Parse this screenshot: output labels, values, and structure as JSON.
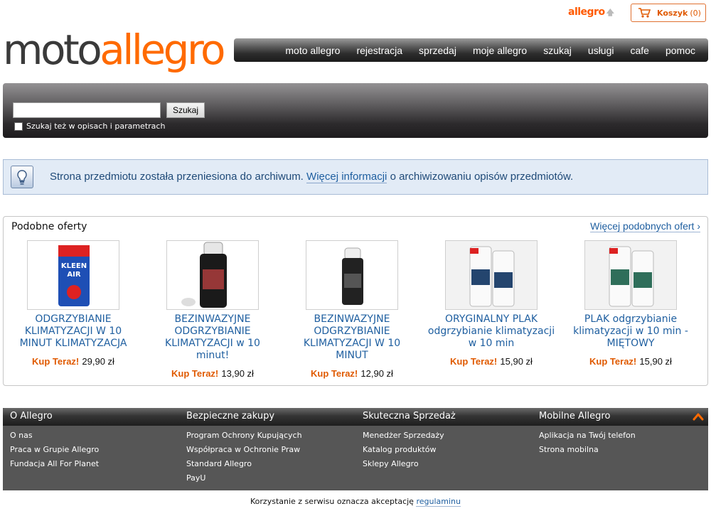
{
  "top": {
    "brand_small": "allegro",
    "cart_label": "Koszyk",
    "cart_count": "(0)"
  },
  "logo": {
    "part1": "moto",
    "part2": "allegro"
  },
  "nav": [
    "moto allegro",
    "rejestracja",
    "sprzedaj",
    "moje allegro",
    "szukaj",
    "usługi",
    "cafe",
    "pomoc"
  ],
  "search": {
    "value": "",
    "button": "Szukaj",
    "checkbox_label": "Szukaj też w opisach i parametrach",
    "checkbox_checked": false
  },
  "info": {
    "text_before": "Strona przedmiotu została przeniesiona do archiwum.",
    "link": "Więcej informacji",
    "text_after": "o archiwizowaniu opisów przedmiotów."
  },
  "similar": {
    "title": "Podobne oferty",
    "more_link": "Więcej podobnych ofert ›",
    "offers": [
      {
        "title": "ODGRZYBIANIE KLIMATYZACJI W 10 MINUT KLIMATYZACJA",
        "buy_label": "Kup Teraz!",
        "price": "29,90 zł",
        "image": "kleen-air-can"
      },
      {
        "title": "BEZINWAZYJNE ODGRZYBIANIE KLIMATYZACJI w 10 minut!",
        "buy_label": "Kup Teraz!",
        "price": "13,90 zł",
        "image": "spray-can-black"
      },
      {
        "title": "BEZINWAZYJNE ODGRZYBIANIE KLIMATYZACJI W 10 MINUT",
        "buy_label": "Kup Teraz!",
        "price": "12,90 zł",
        "image": "spray-can-small"
      },
      {
        "title": "ORYGINALNY PLAK odgrzybianie klimatyzacji w 10 min",
        "buy_label": "Kup Teraz!",
        "price": "15,90 zł",
        "image": "plak-cans"
      },
      {
        "title": "PLAK odgrzybianie klimatyzacji w 10 min - MIĘTOWY",
        "buy_label": "Kup Teraz!",
        "price": "15,90 zł",
        "image": "plak-cans"
      }
    ]
  },
  "footer": {
    "columns": [
      {
        "heading": "O Allegro",
        "links": [
          "O nas",
          "Praca w Grupie Allegro",
          "Fundacja All For Planet"
        ]
      },
      {
        "heading": "Bezpieczne zakupy",
        "links": [
          "Program Ochrony Kupujących",
          "Współpraca w Ochronie Praw",
          "Standard Allegro",
          "PayU"
        ]
      },
      {
        "heading": "Skuteczna Sprzedaż",
        "links": [
          "Menedżer Sprzedaży",
          "Katalog produktów",
          "Sklepy Allegro"
        ]
      },
      {
        "heading": "Mobilne Allegro",
        "links": [
          "Aplikacja na Twój telefon",
          "Strona mobilna"
        ]
      }
    ]
  },
  "legal": {
    "text": "Korzystanie z serwisu oznacza akceptację",
    "link": "regulaminu"
  },
  "colors": {
    "accent": "#ff6a00",
    "link": "#1f5fa0",
    "info_bg": "#e2ebf6",
    "footer_bg": "#565656"
  }
}
